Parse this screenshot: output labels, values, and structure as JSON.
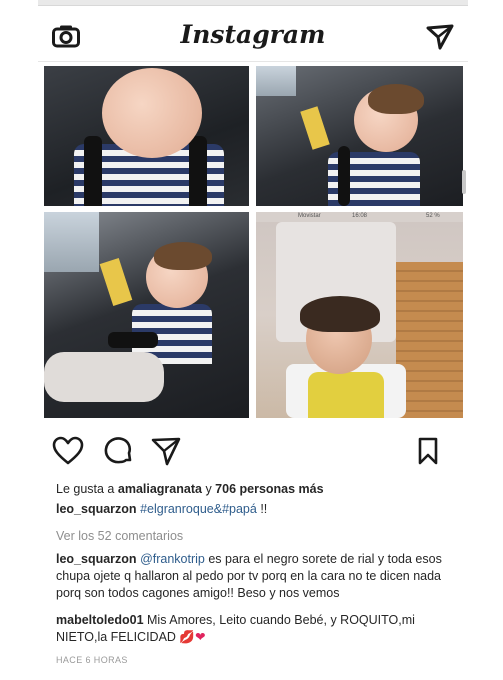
{
  "header": {
    "logo": "Instagram",
    "camera_icon": "camera-icon",
    "direct_icon": "paper-plane-icon"
  },
  "post": {
    "images": [
      {
        "name": "baby-sleeping-car-seat-closeup"
      },
      {
        "name": "baby-sleeping-car-seat-side"
      },
      {
        "name": "baby-sleeping-car-seat-full"
      },
      {
        "name": "old-photo-baby-yellow-vest"
      }
    ],
    "inner_status": {
      "carrier": "Movistar",
      "time": "16:08",
      "battery": "52 %"
    },
    "likes": {
      "prefix": "Le gusta a",
      "user": "amaliagranata",
      "connector": "y",
      "count": "706 personas más"
    },
    "caption": {
      "user": "leo_squarzon",
      "tags": "#elgranroque&#papá",
      "suffix": "!!"
    },
    "view_all": "Ver los 52 comentarios",
    "comments": [
      {
        "user": "leo_squarzon",
        "mention": "@frankotrip",
        "text": "es para el negro sorete de rial y toda esos chupa ojete q hallaron al pedo por tv porq en la cara no te dicen nada porq son todos cagones amigo!! Beso y nos vemos"
      },
      {
        "user": "mabeltoledo01",
        "text": "Mis Amores, Leito cuando Bebé, y ROQUITO,mi NIETO,la FELICIDAD",
        "emoji1": "💋",
        "emoji2": "❤"
      }
    ],
    "timestamp": "HACE 6 HORAS"
  },
  "colors": {
    "link": "#2f5d8c",
    "muted": "#8e8e8e",
    "text": "#262626"
  }
}
